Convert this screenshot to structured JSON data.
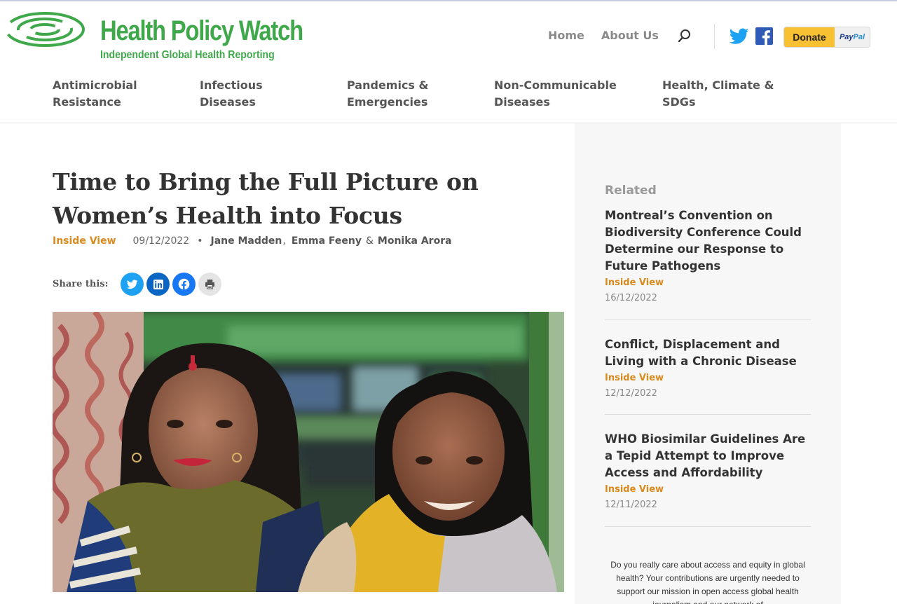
{
  "brand": {
    "title": "Health Policy Watch",
    "subtitle": "Independent Global Health Reporting",
    "color": "#3ea84a"
  },
  "topnav": {
    "home": "Home",
    "about": "About Us",
    "search_icon": "search-icon",
    "donate_label": "Donate",
    "paypal_pay": "Pay",
    "paypal_pal": "Pal"
  },
  "categories": [
    "Antimicrobial Resistance",
    "Infectious Diseases",
    "Pandemics & Emergencies",
    "Non-Communicable Diseases",
    "Health, Climate & SDGs"
  ],
  "article": {
    "title": "Time to Bring the Full Picture on Women’s Health into Focus",
    "category": "Inside View",
    "date": "09/12/2022",
    "authors": [
      "Jane Madden",
      "Emma Feeny",
      "Monika Arora"
    ],
    "author_sep_1": ",",
    "author_sep_2": "&",
    "share_label": "Share this:"
  },
  "sidebar": {
    "heading": "Related",
    "items": [
      {
        "title": "Montreal’s Convention on Biodiversity Conference Could Determine our Response to Future Pathogens",
        "category": "Inside View",
        "date": "16/12/2022"
      },
      {
        "title": "Conflict, Displacement and Living with a Chronic Disease",
        "category": "Inside View",
        "date": "12/12/2022"
      },
      {
        "title": "WHO Biosimilar Guidelines Are a Tepid Attempt to Improve Access and Affordability",
        "category": "Inside View",
        "date": "12/11/2022"
      }
    ],
    "appeal": "Do you really care about access and equity in global health? Your contributions are urgently needed to support our mission in open access global health journalism and our network of"
  },
  "colors": {
    "accent_orange": "#d98a1f",
    "twitter": "#1da1f2",
    "linkedin": "#0a66c2",
    "facebook": "#1877f2",
    "donate_yellow": "#f8c134"
  }
}
